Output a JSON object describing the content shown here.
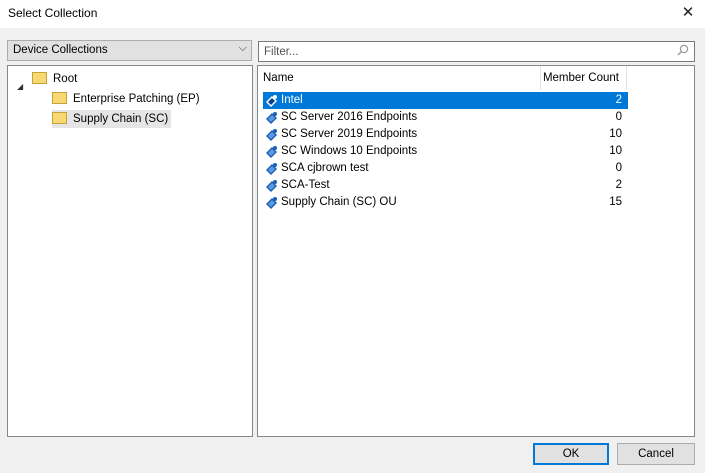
{
  "window": {
    "title": "Select Collection",
    "close_glyph": "✕"
  },
  "collection_type": {
    "selected": "Device Collections",
    "chevron": "⌵"
  },
  "tree": {
    "expander": "◢",
    "nodes": [
      {
        "label": "Root",
        "icon": "folder-icon"
      },
      {
        "label": "Enterprise Patching (EP)",
        "icon": "folder-icon"
      },
      {
        "label": "Supply Chain (SC)",
        "icon": "folder-icon",
        "selected": true
      }
    ]
  },
  "filter": {
    "placeholder": "Filter...",
    "value": ""
  },
  "list": {
    "columns": [
      "Name",
      "Member Count"
    ],
    "rows": [
      {
        "name": "Intel",
        "count": "2",
        "selected": true
      },
      {
        "name": "SC Server 2016 Endpoints",
        "count": "0"
      },
      {
        "name": "SC Server 2019 Endpoints",
        "count": "10"
      },
      {
        "name": "SC Windows 10 Endpoints",
        "count": "10"
      },
      {
        "name": "SCA cjbrown test",
        "count": "0"
      },
      {
        "name": "SCA-Test",
        "count": "2"
      },
      {
        "name": "Supply Chain (SC) OU",
        "count": "15"
      }
    ]
  },
  "buttons": {
    "ok": "OK",
    "cancel": "Cancel"
  },
  "colors": {
    "selection": "#0078d7",
    "folder": "#f8d775",
    "collection_icon": "#1c5fb8"
  }
}
